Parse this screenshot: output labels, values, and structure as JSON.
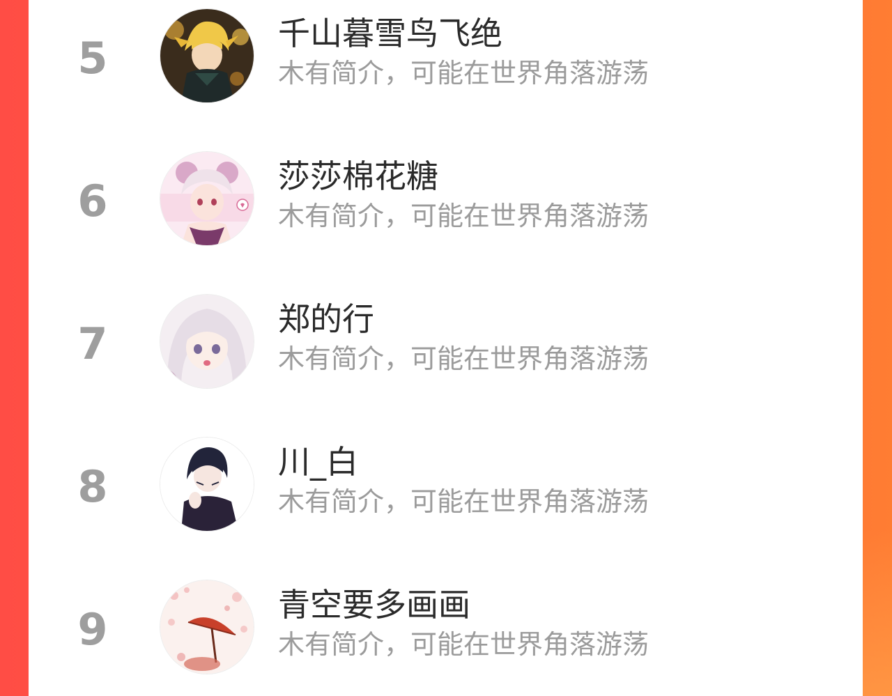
{
  "colors": {
    "accent_left": "#ff4d45",
    "accent_right": "#ff7d33",
    "rank_text": "#9e9e9e",
    "name_text": "#2a2a2a",
    "intro_text": "#9b9b9b",
    "card_bg": "#ffffff"
  },
  "ranking": {
    "entries": [
      {
        "rank": "5",
        "name": "千山暮雪鸟飞绝",
        "intro": "木有简介，可能在世界角落游荡",
        "avatar_icon": "avatar-blonde-warrior"
      },
      {
        "rank": "6",
        "name": "莎莎棉花糖",
        "intro": "木有简介，可能在世界角落游荡",
        "avatar_icon": "avatar-pink-twin-buns-girl"
      },
      {
        "rank": "7",
        "name": "郑的行",
        "intro": "木有简介，可能在世界角落游荡",
        "avatar_icon": "avatar-silver-hair-girl"
      },
      {
        "rank": "8",
        "name": "川_白",
        "intro": "木有简介，可能在世界角落游荡",
        "avatar_icon": "avatar-dark-hair-boy"
      },
      {
        "rank": "9",
        "name": "青空要多画画",
        "intro": "木有简介，可能在世界角落游荡",
        "avatar_icon": "avatar-red-umbrella-blossoms"
      }
    ]
  }
}
